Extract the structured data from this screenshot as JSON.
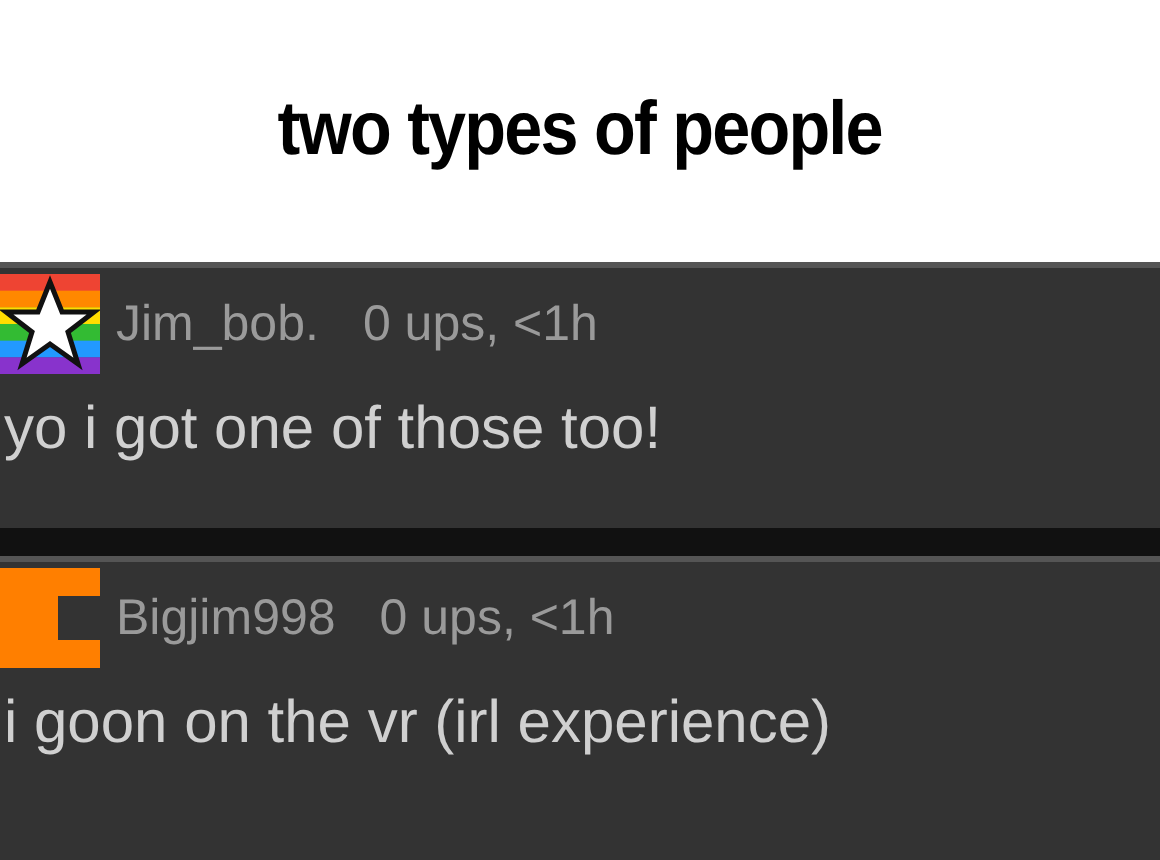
{
  "title": "two types of people",
  "comments": [
    {
      "avatar": {
        "kind": "rainbow-star"
      },
      "username": "Jim_bob.",
      "meta": "0 ups, <1h",
      "text": "yo i got one of those too!"
    },
    {
      "avatar": {
        "kind": "orange-block"
      },
      "username": "Bigjim998",
      "meta": "0 ups, <1h",
      "text": "i goon on the vr (irl experience)"
    }
  ]
}
